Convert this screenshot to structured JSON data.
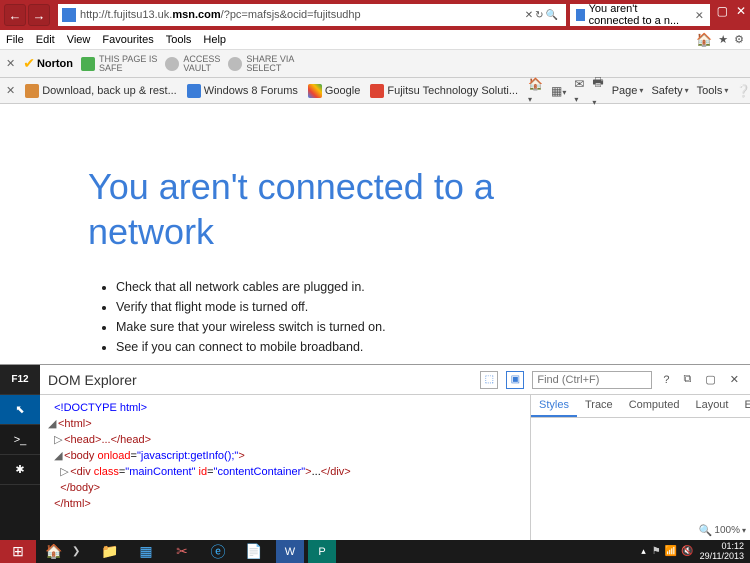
{
  "titlebar": {
    "url_display": "http://t.fujitsu13.uk.msn.com/?pc=mafsjs&ocid=fujitsudhp",
    "url_host": "msn.com",
    "tab_title": "You aren't connected to a n..."
  },
  "menubar": {
    "items": [
      "File",
      "Edit",
      "View",
      "Favourites",
      "Tools",
      "Help"
    ]
  },
  "norton": {
    "brand": "Norton",
    "safe_label": "THIS PAGE IS",
    "safe_value": "SAFE",
    "vault_label": "ACCESS",
    "vault_value": "VAULT",
    "share_label": "SHARE VIA",
    "share_value": "SELECT"
  },
  "bookmarks": {
    "items": [
      "Download, back up & rest...",
      "Windows 8 Forums",
      "Google",
      "Fujitsu Technology Soluti..."
    ],
    "right": [
      "Page",
      "Safety",
      "Tools"
    ]
  },
  "page": {
    "heading": "You aren't connected to a network",
    "bullets": [
      "Check that all network cables are plugged in.",
      "Verify that flight mode is turned off.",
      "Make sure that your wireless switch is turned on.",
      "See if you can connect to mobile broadband."
    ]
  },
  "devtools": {
    "f12": "F12",
    "title": "DOM Explorer",
    "find_placeholder": "Find (Ctrl+F)",
    "lines": {
      "doctype": "<!DOCTYPE html>",
      "html_open": "<html>",
      "head": "<head>...</head>",
      "body_open_tag": "body",
      "body_attr_name": "onload",
      "body_attr_val": "javascript:getInfo();",
      "div_tag": "div",
      "div_attr1_name": "class",
      "div_attr1_val": "mainContent",
      "div_attr2_name": "id",
      "div_attr2_val": "contentContainer",
      "div_close": "</div>",
      "body_close": "</body>",
      "html_close": "</html>"
    },
    "panel_tabs": [
      "Styles",
      "Trace",
      "Computed",
      "Layout",
      "Event"
    ]
  },
  "zoom": "100%",
  "taskbar": {
    "time": "01:12",
    "date": "29/11/2013"
  }
}
